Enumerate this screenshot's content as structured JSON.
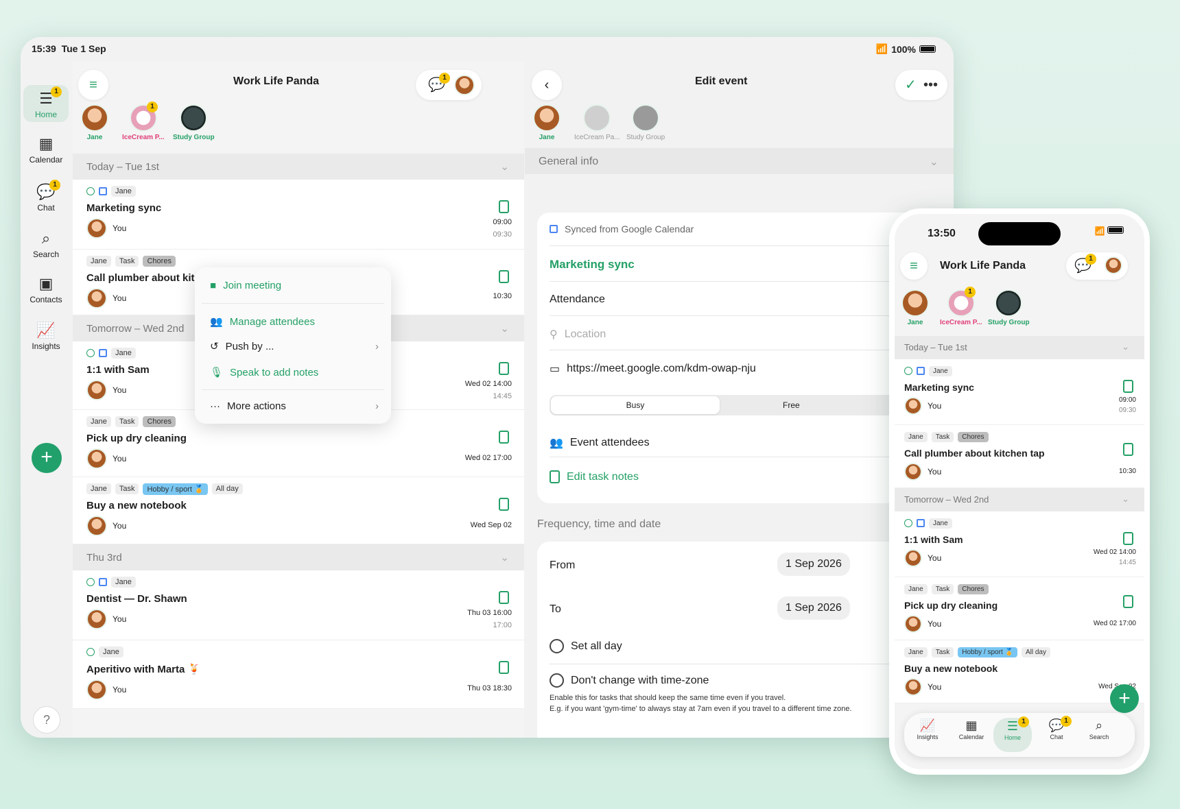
{
  "tablet": {
    "status": {
      "time": "15:39",
      "date": "Tue 1 Sep",
      "battery": "100%"
    },
    "rail": {
      "home": "Home",
      "calendar": "Calendar",
      "chat": "Chat",
      "search": "Search",
      "contacts": "Contacts",
      "insights": "Insights",
      "home_badge": "1",
      "chat_badge": "1",
      "help": "?"
    },
    "left": {
      "title": "Work Life Panda",
      "chat_badge": "1",
      "people": [
        "Jane",
        "IceCream P...",
        "Study Group"
      ],
      "people_badge": "1",
      "today": "Today – Tue 1st",
      "tomorrow": "Tomorrow – Wed 2nd",
      "thu": "Thu 3rd",
      "you": "You",
      "cards": [
        {
          "tags": [
            "Jane"
          ],
          "title": "Marketing sync",
          "t1": "09:00",
          "t2": "09:30"
        },
        {
          "tags": [
            "Jane",
            "Task",
            "Chores"
          ],
          "title": "Call plumber about kitchen tap",
          "t1": "10:30",
          "t2": ""
        },
        {
          "tags": [
            "Jane"
          ],
          "title": "1:1 with Sam",
          "t1": "Wed 02 14:00",
          "t2": "14:45"
        },
        {
          "tags": [
            "Jane",
            "Task",
            "Chores"
          ],
          "title": "Pick up dry cleaning",
          "t1": "Wed 02 17:00",
          "t2": ""
        },
        {
          "tags": [
            "Jane",
            "Task",
            "Hobby / sport 🏅",
            "All day"
          ],
          "title": "Buy a new notebook",
          "t1": "Wed Sep 02",
          "t2": ""
        },
        {
          "tags": [
            "Jane"
          ],
          "title": "Dentist — Dr. Shawn",
          "t1": "Thu 03 16:00",
          "t2": "17:00"
        },
        {
          "tags": [
            "Jane"
          ],
          "title": "Aperitivo with Marta 🍹",
          "t1": "Thu 03 18:30",
          "t2": ""
        }
      ]
    },
    "menu": {
      "join": "Join meeting",
      "manage": "Manage attendees",
      "push": "Push by ...",
      "speak": "Speak to add notes",
      "more": "More actions"
    },
    "right": {
      "title": "Edit event",
      "people": [
        "Jane",
        "IceCream Pa...",
        "Study Group"
      ],
      "general": "General info",
      "synced": "Synced from Google Calendar",
      "event_title": "Marketing sync",
      "attendance": "Attendance",
      "location": "Location",
      "url": "https://meet.google.com/kdm-owap-nju",
      "busy": "Busy",
      "free": "Free",
      "attendees": "Event attendees",
      "notes": "Edit task notes",
      "freq": "Frequency, time and date",
      "from": "From",
      "to": "To",
      "from_date": "1 Sep 2026",
      "to_date": "1 Sep 2026",
      "allday": "Set all day",
      "tz": "Don't change with time-zone",
      "tz_help1": "Enable this for tasks that should keep the same time even if you travel.",
      "tz_help2": "E.g. if you want 'gym-time' to always stay at 7am even if you travel to a different time zone."
    }
  },
  "phone": {
    "time": "13:50",
    "title": "Work Life Panda",
    "chat_badge": "1",
    "people": [
      "Jane",
      "IceCream P...",
      "Study Group"
    ],
    "people_badge": "1",
    "today": "Today – Tue 1st",
    "tomorrow": "Tomorrow – Wed 2nd",
    "you": "You",
    "cards": [
      {
        "tags": [
          "Jane"
        ],
        "title": "Marketing sync",
        "t1": "09:00",
        "t2": "09:30"
      },
      {
        "tags": [
          "Jane",
          "Task",
          "Chores"
        ],
        "title": "Call plumber about kitchen tap",
        "t1": "10:30",
        "t2": ""
      },
      {
        "tags": [
          "Jane"
        ],
        "title": "1:1 with Sam",
        "t1": "Wed 02 14:00",
        "t2": "14:45"
      },
      {
        "tags": [
          "Jane",
          "Task",
          "Chores"
        ],
        "title": "Pick up dry cleaning",
        "t1": "Wed 02 17:00",
        "t2": ""
      },
      {
        "tags": [
          "Jane",
          "Task",
          "Hobby / sport 🏅",
          "All day"
        ],
        "title": "Buy a new notebook",
        "t1": "Wed Sep 02",
        "t2": ""
      }
    ],
    "tabs": {
      "insights": "Insights",
      "calendar": "Calendar",
      "home": "Home",
      "chat": "Chat",
      "search": "Search",
      "home_badge": "1",
      "chat_badge": "1"
    }
  }
}
